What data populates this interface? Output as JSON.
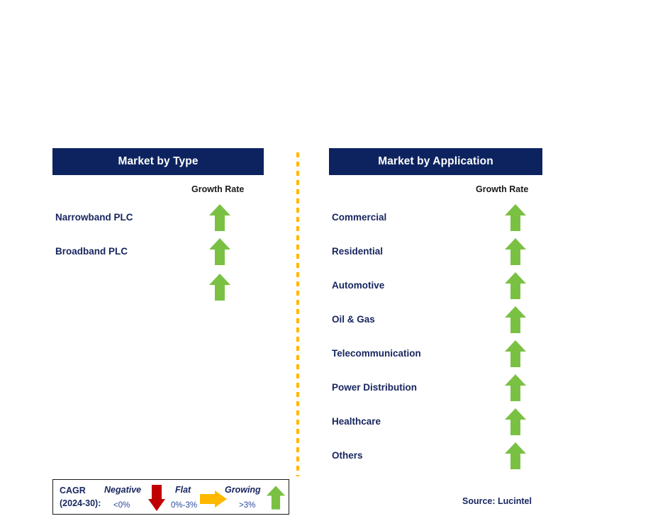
{
  "colors": {
    "header_bar": "#0d2360",
    "header_text": "#ffffff",
    "label_navy": "#17255e",
    "arrow_green": "#7ac143",
    "arrow_red": "#c00000",
    "arrow_amber": "#ffb800",
    "divider_amber": "#ffb800",
    "legend_border": "#1a1a1a",
    "background": "#ffffff"
  },
  "columns": [
    {
      "id": "market-by-type",
      "header": "Market by Type",
      "growth_caption": "Growth Rate",
      "rows": [
        {
          "label": "Narrowband PLC",
          "growth": "up",
          "growth_icon": "arrow-up-green-icon"
        },
        {
          "label": "Broadband PLC",
          "growth": "up",
          "growth_icon": "arrow-up-green-icon"
        },
        {
          "label": "",
          "growth": "up",
          "growth_icon": "arrow-up-green-icon"
        }
      ]
    },
    {
      "id": "market-by-application",
      "header": "Market by Application",
      "growth_caption": "Growth Rate",
      "rows": [
        {
          "label": "Commercial",
          "growth": "up",
          "growth_icon": "arrow-up-green-icon"
        },
        {
          "label": "Residential",
          "growth": "up",
          "growth_icon": "arrow-up-green-icon"
        },
        {
          "label": "Automotive",
          "growth": "up",
          "growth_icon": "arrow-up-green-icon"
        },
        {
          "label": "Oil & Gas",
          "growth": "up",
          "growth_icon": "arrow-up-green-icon"
        },
        {
          "label": "Telecommunication",
          "growth": "up",
          "growth_icon": "arrow-up-green-icon"
        },
        {
          "label": "Power Distribution",
          "growth": "up",
          "growth_icon": "arrow-up-green-icon"
        },
        {
          "label": "Healthcare",
          "growth": "up",
          "growth_icon": "arrow-up-green-icon"
        },
        {
          "label": "Others",
          "growth": "up",
          "growth_icon": "arrow-up-green-icon"
        }
      ]
    }
  ],
  "legend": {
    "title_line1": "CAGR",
    "title_line2": "(2024-30):",
    "entries": [
      {
        "term": "Negative",
        "range": "<0%",
        "icon": "arrow-down-red-icon",
        "direction": "down"
      },
      {
        "term": "Flat",
        "range": "0%-3%",
        "icon": "arrow-right-amber-icon",
        "direction": "right"
      },
      {
        "term": "Growing",
        "range": ">3%",
        "icon": "arrow-up-green-icon",
        "direction": "up"
      }
    ]
  },
  "source": "Source: Lucintel"
}
